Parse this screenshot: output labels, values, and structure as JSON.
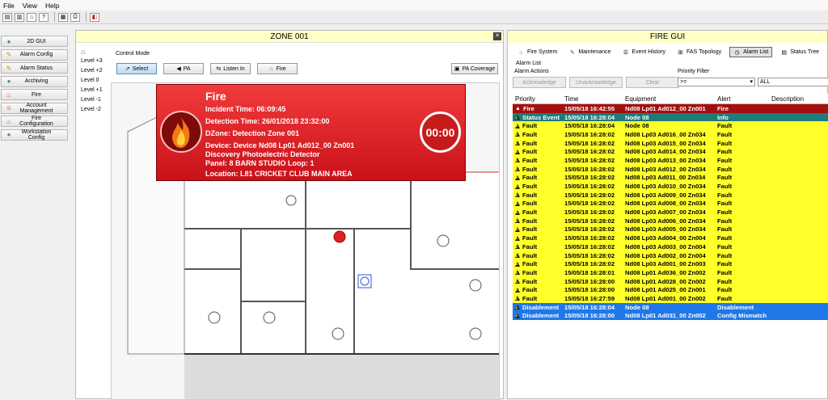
{
  "menu": {
    "items": [
      "File",
      "View",
      "Help"
    ]
  },
  "toolbar_icons": [
    "save-icon",
    "folder-icon",
    "home-icon",
    "help-icon",
    "grid-icon",
    "printer-icon",
    "exit-icon"
  ],
  "nav": {
    "items": [
      {
        "label": "2D GUI",
        "icon": "globe-icon",
        "color": "#3aa34a"
      },
      {
        "label": "Alarm Config",
        "icon": "pencil-icon",
        "color": "#e08a20"
      },
      {
        "label": "Alarm Status",
        "icon": "pencil-icon",
        "color": "#e08a20"
      },
      {
        "label": "Archiving",
        "icon": "globe-icon",
        "color": "#3aa34a"
      },
      {
        "label": "Fire",
        "icon": "fire-icon",
        "color": "#e05010"
      },
      {
        "label": "Account Management",
        "icon": "user-icon",
        "color": "#c0392b"
      },
      {
        "label": "Fire Configuration",
        "icon": "fire-icon",
        "color": "#e05010"
      },
      {
        "label": "Workstation Config",
        "icon": "globe-icon",
        "color": "#3aa34a"
      }
    ]
  },
  "zone": {
    "title": "ZONE 001",
    "control_mode": "Control Mode",
    "levels": [
      "Level +3",
      "Level +2",
      "Level 0",
      "Level +1",
      "Level -1",
      "Level -2"
    ],
    "buttons": [
      "Select",
      "PA",
      "Listen In",
      "Fire"
    ],
    "pa_coverage": "PA Coverage"
  },
  "fire_popup": {
    "title": "Fire",
    "incident": "Incident Time: 06:09:45",
    "detection": "Detection Time: 26/01/2018 23:32:00",
    "dzone": "DZone: Detection Zone 001",
    "device": "Device: Device Nd08 Lp01 Ad012_00 Zn001",
    "device2": "Discovery Photoelectric Detector",
    "panel": "Panel: 8 BARN STUDIO Loop: 1",
    "location": "Location: L81 CRICKET CLUB MAIN AREA",
    "timer": "00:00"
  },
  "fire_gui": {
    "title": "FIRE GUI",
    "tabs": [
      {
        "label": "Fire System",
        "icon": "fire-icon"
      },
      {
        "label": "Maintenance",
        "icon": "wrench-icon"
      },
      {
        "label": "Event History",
        "icon": "list-icon"
      },
      {
        "label": "FAS Topology",
        "icon": "network-icon"
      },
      {
        "label": "Alarm List",
        "icon": "clock-icon"
      },
      {
        "label": "Status Tree",
        "icon": "tree-icon"
      }
    ],
    "alarm_list_label": "Alarm List",
    "alarm_actions_label": "Alarm Actions",
    "priority_filter_label": "Priority Filter",
    "actions": [
      "Acknowledge",
      "Unacknowledge",
      "Clear"
    ],
    "filter_op": ">=",
    "filter_val": "ALL",
    "columns": [
      "Priority",
      "Time",
      "Equipment",
      "Alert",
      "Description"
    ],
    "colors": {
      "fire": "#a50f0f",
      "status": "#1f7a7a",
      "fault": "#ffff2a",
      "disable": "#1e78e8"
    },
    "rows": [
      {
        "p": "Fire",
        "t": "15/05/18 16:42:55",
        "e": "Nd08 Lp01 Ad012_00 Zn001",
        "a": "Fire",
        "type": "fire"
      },
      {
        "p": "Status Event",
        "t": "15/05/18 16:28:04",
        "e": "Node 08",
        "a": "Info",
        "type": "status"
      },
      {
        "p": "Fault",
        "t": "15/05/18 16:28:04",
        "e": "Node 08",
        "a": "Fault",
        "type": "fault"
      },
      {
        "p": "Fault",
        "t": "15/05/18 16:28:02",
        "e": "Nd08 Lp03 Ad016_00 Zn034",
        "a": "Fault",
        "type": "fault"
      },
      {
        "p": "Fault",
        "t": "15/05/18 16:28:02",
        "e": "Nd08 Lp03 Ad015_00 Zn034",
        "a": "Fault",
        "type": "fault"
      },
      {
        "p": "Fault",
        "t": "15/05/18 16:28:02",
        "e": "Nd08 Lp03 Ad014_00 Zn034",
        "a": "Fault",
        "type": "fault"
      },
      {
        "p": "Fault",
        "t": "15/05/18 16:28:02",
        "e": "Nd08 Lp03 Ad013_00 Zn034",
        "a": "Fault",
        "type": "fault"
      },
      {
        "p": "Fault",
        "t": "15/05/18 16:28:02",
        "e": "Nd08 Lp03 Ad012_00 Zn034",
        "a": "Fault",
        "type": "fault"
      },
      {
        "p": "Fault",
        "t": "15/05/18 16:28:02",
        "e": "Nd08 Lp03 Ad011_00 Zn034",
        "a": "Fault",
        "type": "fault"
      },
      {
        "p": "Fault",
        "t": "15/05/18 16:28:02",
        "e": "Nd08 Lp03 Ad010_00 Zn034",
        "a": "Fault",
        "type": "fault"
      },
      {
        "p": "Fault",
        "t": "15/05/18 16:28:02",
        "e": "Nd08 Lp03 Ad009_00 Zn034",
        "a": "Fault",
        "type": "fault"
      },
      {
        "p": "Fault",
        "t": "15/05/18 16:28:02",
        "e": "Nd08 Lp03 Ad008_00 Zn034",
        "a": "Fault",
        "type": "fault"
      },
      {
        "p": "Fault",
        "t": "15/05/18 16:28:02",
        "e": "Nd08 Lp03 Ad007_00 Zn034",
        "a": "Fault",
        "type": "fault"
      },
      {
        "p": "Fault",
        "t": "15/05/18 16:28:02",
        "e": "Nd08 Lp03 Ad006_00 Zn034",
        "a": "Fault",
        "type": "fault"
      },
      {
        "p": "Fault",
        "t": "15/05/18 16:28:02",
        "e": "Nd08 Lp03 Ad005_00 Zn034",
        "a": "Fault",
        "type": "fault"
      },
      {
        "p": "Fault",
        "t": "15/05/18 16:28:02",
        "e": "Nd08 Lp03 Ad004_00 Zn004",
        "a": "Fault",
        "type": "fault"
      },
      {
        "p": "Fault",
        "t": "15/05/18 16:28:02",
        "e": "Nd08 Lp03 Ad003_00 Zn004",
        "a": "Fault",
        "type": "fault"
      },
      {
        "p": "Fault",
        "t": "15/05/18 16:28:02",
        "e": "Nd08 Lp03 Ad002_00 Zn004",
        "a": "Fault",
        "type": "fault"
      },
      {
        "p": "Fault",
        "t": "15/05/18 16:28:02",
        "e": "Nd08 Lp03 Ad001_00 Zn003",
        "a": "Fault",
        "type": "fault"
      },
      {
        "p": "Fault",
        "t": "15/05/18 16:28:01",
        "e": "Nd08 Lp01 Ad036_00 Zn002",
        "a": "Fault",
        "type": "fault"
      },
      {
        "p": "Fault",
        "t": "15/05/18 16:28:00",
        "e": "Nd08 Lp01 Ad028_00 Zn002",
        "a": "Fault",
        "type": "fault"
      },
      {
        "p": "Fault",
        "t": "15/05/18 16:28:00",
        "e": "Nd08 Lp01 Ad025_00 Zn001",
        "a": "Fault",
        "type": "fault"
      },
      {
        "p": "Fault",
        "t": "15/05/18 16:27:59",
        "e": "Nd08 Lp01 Ad001_00 Zn002",
        "a": "Fault",
        "type": "fault"
      },
      {
        "p": "Disablement",
        "t": "15/05/18 16:28:04",
        "e": "Node 08",
        "a": "Disablement",
        "type": "disable"
      },
      {
        "p": "Disablement",
        "t": "15/05/18 16:28:00",
        "e": "Nd08 Lp01 Ad031_00 Zn002",
        "a": "Config Mismatch",
        "type": "disable"
      }
    ]
  }
}
